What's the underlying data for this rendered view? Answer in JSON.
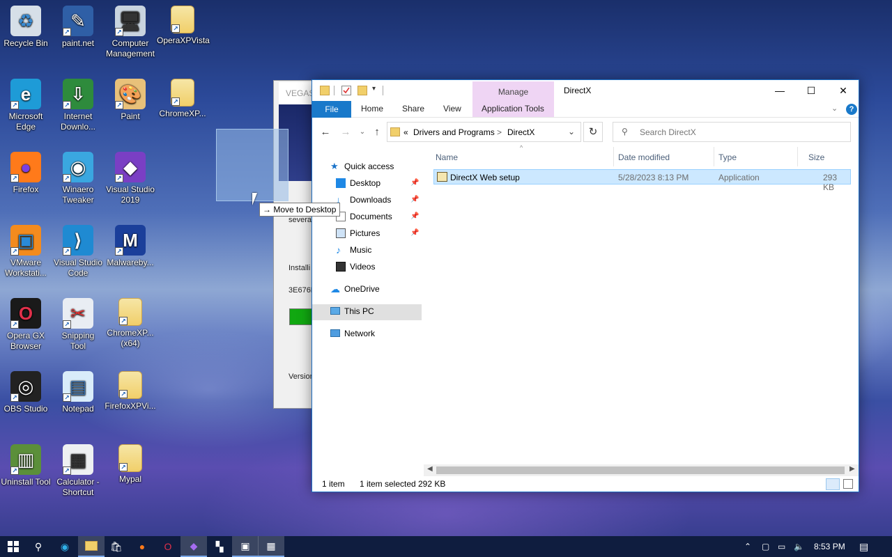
{
  "desktop": {
    "icons": [
      {
        "label": "Recycle Bin",
        "icon": "recycle-bin-icon"
      },
      {
        "label": "paint.net",
        "icon": "paintnet-icon"
      },
      {
        "label": "Computer\nManagement",
        "icon": "computer-management-icon"
      },
      {
        "label": "OperaXPVista",
        "icon": "folder-icon"
      },
      {
        "label": "Microsoft\nEdge",
        "icon": "edge-icon"
      },
      {
        "label": "Internet\nDownlo...",
        "icon": "internet-download-icon"
      },
      {
        "label": "Paint",
        "icon": "paint-icon"
      },
      {
        "label": "ChromeXP...",
        "icon": "folder-icon"
      },
      {
        "label": "Firefox",
        "icon": "firefox-icon"
      },
      {
        "label": "Winaero\nTweaker",
        "icon": "winaero-icon"
      },
      {
        "label": "Visual Studio\n2019",
        "icon": "visual-studio-icon"
      },
      {
        "label": "VMware\nWorkstati...",
        "icon": "vmware-icon"
      },
      {
        "label": "Visual Studio\nCode",
        "icon": "vscode-icon"
      },
      {
        "label": "Malwareby...",
        "icon": "malwarebytes-icon"
      },
      {
        "label": "Opera GX\nBrowser",
        "icon": "opera-gx-icon"
      },
      {
        "label": "Snipping\nTool",
        "icon": "snipping-tool-icon"
      },
      {
        "label": "ChromeXP...\n(x64)",
        "icon": "folder-icon"
      },
      {
        "label": "OBS Studio",
        "icon": "obs-icon"
      },
      {
        "label": "Notepad",
        "icon": "notepad-icon"
      },
      {
        "label": "FirefoxXPVi...",
        "icon": "folder-icon"
      },
      {
        "label": "Uninstall Tool",
        "icon": "uninstall-tool-icon"
      },
      {
        "label": "Calculator -\nShortcut",
        "icon": "calculator-icon"
      },
      {
        "label": "Mypal",
        "icon": "folder-icon"
      }
    ]
  },
  "vegas": {
    "title": "VEGAS",
    "text1": "severa",
    "text2": "Installi",
    "text3": "3E676D",
    "text4": "Version"
  },
  "drag": {
    "tooltip": "→ Move to Desktop"
  },
  "explorer": {
    "title": "DirectX",
    "manage_tab": "Manage",
    "ribbon": {
      "file": "File",
      "home": "Home",
      "share": "Share",
      "view": "View",
      "application_tools": "Application Tools",
      "help": "?"
    },
    "address": {
      "overflow": "«",
      "crumb1": "Drivers and Programs",
      "sep": ">",
      "crumb2": "DirectX"
    },
    "search_placeholder": "Search DirectX",
    "nav": {
      "quick_access": "Quick access",
      "desktop": "Desktop",
      "downloads": "Downloads",
      "documents": "Documents",
      "pictures": "Pictures",
      "music": "Music",
      "videos": "Videos",
      "onedrive": "OneDrive",
      "this_pc": "This PC",
      "network": "Network"
    },
    "columns": {
      "name": "Name",
      "date_modified": "Date modified",
      "type": "Type",
      "size": "Size"
    },
    "files": [
      {
        "name": "DirectX Web setup",
        "date": "5/28/2023 8:13 PM",
        "type": "Application",
        "size": "293 KB"
      }
    ],
    "status": {
      "count": "1 item",
      "selected": "1 item selected",
      "selected_size": "292 KB"
    }
  },
  "taskbar": {
    "time": "8:53 PM",
    "accent": "#7aa7e8"
  }
}
